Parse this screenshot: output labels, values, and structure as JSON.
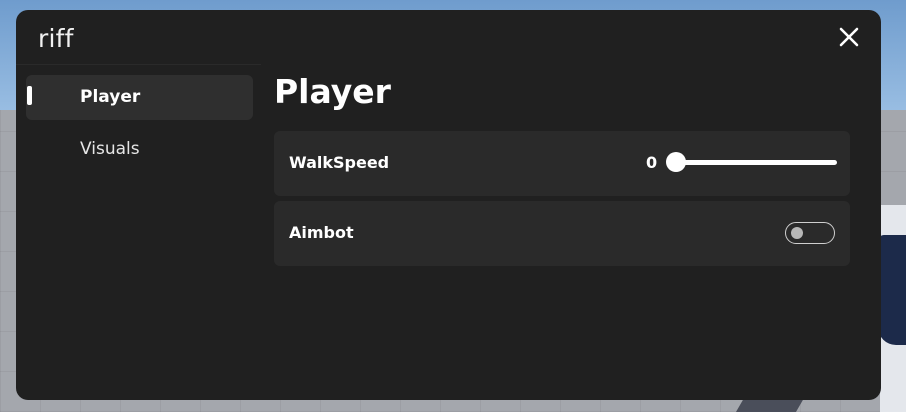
{
  "window": {
    "title": "riff"
  },
  "sidebar": {
    "items": [
      {
        "label": "Player",
        "active": true
      },
      {
        "label": "Visuals",
        "active": false
      }
    ]
  },
  "main": {
    "title": "Player",
    "walkspeed": {
      "label": "WalkSpeed",
      "value": "0"
    },
    "aimbot": {
      "label": "Aimbot",
      "enabled": false
    }
  },
  "icons": {
    "close": "close-icon"
  },
  "colors": {
    "window_bg": "#202020",
    "row_bg": "#2a2a2a",
    "active_nav_bg": "#2f2f2f",
    "text": "#ffffff"
  }
}
